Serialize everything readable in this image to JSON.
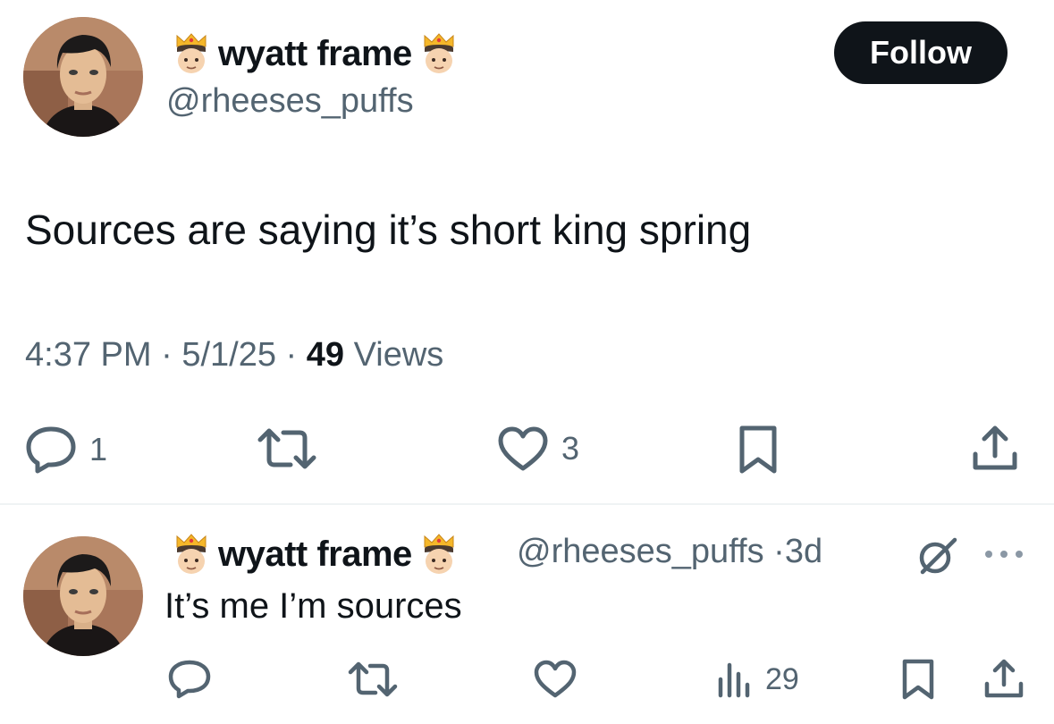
{
  "tweet": {
    "author": {
      "display_name": "wyatt frame",
      "handle": "@rheeses_puffs",
      "name_emoji": "crown-man-emoji"
    },
    "follow_label": "Follow",
    "text": "Sources are saying it’s short king spring",
    "time": "4:37 PM",
    "date": "5/1/25",
    "views_count": "49",
    "views_label": "Views",
    "separator": "·",
    "stats": {
      "replies": "1",
      "reposts": "",
      "likes": "3"
    },
    "icons": [
      "reply-icon",
      "repost-icon",
      "like-icon",
      "bookmark-icon",
      "share-icon"
    ]
  },
  "reply": {
    "author": {
      "display_name": "wyatt frame",
      "handle": "@rheeses_puffs"
    },
    "age": "3d",
    "separator": "·",
    "text": "It’s me I’m sources",
    "views": "29",
    "icons": [
      "grok-icon",
      "more-icon",
      "reply-icon",
      "repost-icon",
      "like-icon",
      "views-icon",
      "bookmark-icon",
      "share-icon"
    ]
  },
  "colors": {
    "text_primary": "#0f1419",
    "text_secondary": "#536471",
    "divider": "#eff3f4",
    "follow_bg": "#0f1419",
    "follow_text": "#ffffff"
  }
}
